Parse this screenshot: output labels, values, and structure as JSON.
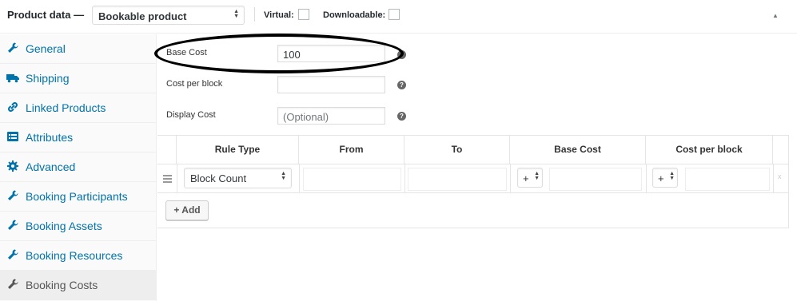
{
  "header": {
    "title": "Product data —",
    "product_type": "Bookable product",
    "virtual_label": "Virtual:",
    "downloadable_label": "Downloadable:"
  },
  "sidebar": {
    "items": [
      {
        "label": "General",
        "icon": "wrench-icon",
        "active": false
      },
      {
        "label": "Shipping",
        "icon": "truck-icon",
        "active": false
      },
      {
        "label": "Linked Products",
        "icon": "link-icon",
        "active": false
      },
      {
        "label": "Attributes",
        "icon": "list-icon",
        "active": false
      },
      {
        "label": "Advanced",
        "icon": "gear-icon",
        "active": false
      },
      {
        "label": "Booking Participants",
        "icon": "wrench-icon",
        "active": false
      },
      {
        "label": "Booking Assets",
        "icon": "wrench-icon",
        "active": false
      },
      {
        "label": "Booking Resources",
        "icon": "wrench-icon",
        "active": false
      },
      {
        "label": "Booking Costs",
        "icon": "wrench-icon",
        "active": true
      }
    ]
  },
  "fields": {
    "base_cost_label": "Base Cost",
    "base_cost_value": "100",
    "cost_per_block_label": "Cost per block",
    "cost_per_block_value": "",
    "display_cost_label": "Display Cost",
    "display_cost_placeholder": "(Optional)",
    "help_glyph": "?"
  },
  "rules_table": {
    "headers": [
      "Rule Type",
      "From",
      "To",
      "Base Cost",
      "Cost per block"
    ],
    "row": {
      "rule_type": "Block Count",
      "base_cost_modifier": "+",
      "block_cost_modifier": "+",
      "remove_glyph": "x"
    },
    "add_button": "+ Add"
  },
  "colors": {
    "link": "#0073aa",
    "active_tab_bg": "#eeeeee",
    "annotation": "#000000"
  }
}
